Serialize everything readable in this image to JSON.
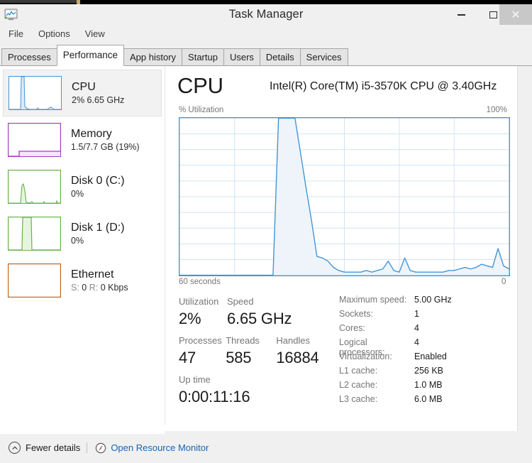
{
  "window": {
    "title": "Task Manager",
    "app_icon": "task-manager-icon",
    "controls": {
      "minimize": "minimize-icon",
      "maximize": "maximize-icon",
      "close": "close-icon"
    }
  },
  "menubar": {
    "items": [
      "File",
      "Options",
      "View"
    ]
  },
  "tabs": {
    "active": "Performance",
    "items": [
      "Processes",
      "Performance",
      "App history",
      "Startup",
      "Users",
      "Details",
      "Services"
    ]
  },
  "sidebar": {
    "items": [
      {
        "name": "CPU",
        "detail": "2%  6.65 GHz",
        "detail_dim": "",
        "color": "#4397d3",
        "selected": true
      },
      {
        "name": "Memory",
        "detail": "1.5/7.7 GB (19%)",
        "detail_dim": "",
        "color": "#a23ec0",
        "selected": false
      },
      {
        "name": "Disk 0 (C:)",
        "detail": "0%",
        "detail_dim": "",
        "color": "#6ab24a",
        "selected": false
      },
      {
        "name": "Disk 1 (D:)",
        "detail": "0%",
        "detail_dim": "",
        "color": "#6ab24a",
        "selected": false
      },
      {
        "name": "Ethernet",
        "detail": "S: 0 R: 0 Kbps",
        "detail_dim": "S: R:",
        "color": "#c1651d",
        "selected": false
      }
    ]
  },
  "main": {
    "title": "CPU",
    "subtitle": "Intel(R) Core(TM) i5-3570K CPU @ 3.40GHz",
    "axis_y_label": "% Utilization",
    "axis_y_max": "100%",
    "axis_x_left": "60 seconds",
    "axis_x_right": "0",
    "stats": {
      "utilization_label": "Utilization",
      "utilization_value": "2%",
      "speed_label": "Speed",
      "speed_value": "6.65 GHz",
      "processes_label": "Processes",
      "processes_value": "47",
      "threads_label": "Threads",
      "threads_value": "585",
      "handles_label": "Handles",
      "handles_value": "16884",
      "uptime_label": "Up time",
      "uptime_value": "0:00:11:16"
    },
    "specs": [
      {
        "key": "Maximum speed:",
        "value": "5.00 GHz"
      },
      {
        "key": "Sockets:",
        "value": "1"
      },
      {
        "key": "Cores:",
        "value": "4"
      },
      {
        "key": "Logical processors:",
        "value": "4"
      },
      {
        "key": "Virtualization:",
        "value": "Enabled"
      },
      {
        "key": "L1 cache:",
        "value": "256 KB"
      },
      {
        "key": "L2 cache:",
        "value": "1.0 MB"
      },
      {
        "key": "L3 cache:",
        "value": "6.0 MB"
      }
    ]
  },
  "footer": {
    "fewer_details": "Fewer details",
    "fewer_icon": "chevron-up-circle-icon",
    "monitor_icon": "resource-monitor-icon",
    "open_resource_monitor": "Open Resource Monitor",
    "link_color": "#1464b4"
  },
  "chart_data": {
    "type": "area",
    "title": "% Utilization",
    "xlabel": "60 seconds",
    "ylabel": "% Utilization",
    "ylim": [
      0,
      100
    ],
    "xlim": [
      60,
      0
    ],
    "grid": true,
    "grid_rows": 10,
    "grid_cols": 6,
    "line_color": "#4397d3",
    "fill_color": "#eef4fa",
    "series": [
      {
        "name": "CPU utilization",
        "x": [
          60,
          59,
          58,
          57,
          56,
          55,
          54,
          53,
          52,
          51,
          50,
          49,
          48,
          47,
          46,
          45,
          44,
          43,
          42,
          41,
          40,
          39,
          38,
          37,
          36,
          35,
          34,
          33,
          32,
          31,
          30,
          29,
          28,
          27,
          26,
          25,
          24,
          23,
          22,
          21,
          20,
          19,
          18,
          17,
          16,
          15,
          14,
          13,
          12,
          11,
          10,
          9,
          8,
          7,
          6,
          5,
          4,
          3,
          2,
          1,
          0
        ],
        "values": [
          0,
          0,
          0,
          0,
          0,
          0,
          0,
          0,
          0,
          0,
          0,
          0,
          0,
          0,
          0,
          0,
          0,
          0,
          100,
          100,
          100,
          100,
          78,
          56,
          35,
          12,
          11,
          9,
          5,
          3,
          2,
          2,
          2,
          2,
          3,
          2,
          3,
          4,
          9,
          3,
          2,
          11,
          3,
          2,
          2,
          2,
          2,
          2,
          2,
          3,
          3,
          4,
          5,
          4,
          5,
          7,
          6,
          5,
          17,
          6,
          4
        ]
      }
    ]
  }
}
